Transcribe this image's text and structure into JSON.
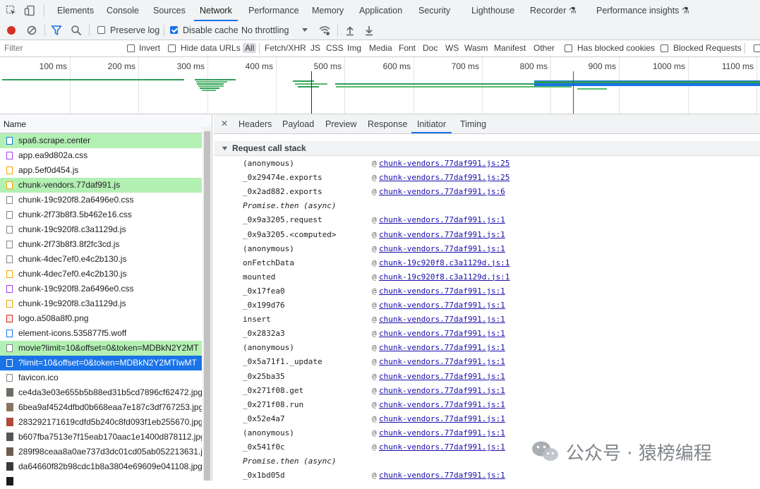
{
  "tabs": [
    "Elements",
    "Console",
    "Sources",
    "Network",
    "Performance",
    "Memory",
    "Application",
    "Security",
    "Lighthouse",
    "Recorder ⚗",
    "Performance insights ⚗"
  ],
  "active_tab": "Network",
  "controls": {
    "preserve_log": "Preserve log",
    "disable_cache": "Disable cache",
    "throttling": "No throttling"
  },
  "filter": {
    "placeholder": "Filter",
    "invert": "Invert",
    "hide_data_urls": "Hide data URLs",
    "types": [
      "All",
      "Fetch/XHR",
      "JS",
      "CSS",
      "Img",
      "Media",
      "Font",
      "Doc",
      "WS",
      "Wasm",
      "Manifest",
      "Other"
    ],
    "has_blocked_cookies": "Has blocked cookies",
    "blocked_requests": "Blocked Requests"
  },
  "timeline": {
    "ticks": [
      "100 ms",
      "200 ms",
      "300 ms",
      "400 ms",
      "500 ms",
      "600 ms",
      "700 ms",
      "800 ms",
      "900 ms",
      "1000 ms",
      "1100 ms"
    ]
  },
  "requests": {
    "header": "Name",
    "rows": [
      {
        "name": "spa6.scrape.center",
        "type": "doc",
        "hl": "green"
      },
      {
        "name": "app.ea9d802a.css",
        "type": "css",
        "hl": ""
      },
      {
        "name": "app.5ef0d454.js",
        "type": "js",
        "hl": ""
      },
      {
        "name": "chunk-vendors.77daf991.js",
        "type": "js",
        "hl": "green"
      },
      {
        "name": "chunk-19c920f8.2a6496e0.css",
        "type": "blank",
        "hl": ""
      },
      {
        "name": "chunk-2f73b8f3.5b462e16.css",
        "type": "blank",
        "hl": ""
      },
      {
        "name": "chunk-19c920f8.c3a1129d.js",
        "type": "blank",
        "hl": ""
      },
      {
        "name": "chunk-2f73b8f3.8f2fc3cd.js",
        "type": "blank",
        "hl": ""
      },
      {
        "name": "chunk-4dec7ef0.e4c2b130.js",
        "type": "blank",
        "hl": ""
      },
      {
        "name": "chunk-4dec7ef0.e4c2b130.js",
        "type": "js",
        "hl": ""
      },
      {
        "name": "chunk-19c920f8.2a6496e0.css",
        "type": "css",
        "hl": ""
      },
      {
        "name": "chunk-19c920f8.c3a1129d.js",
        "type": "js",
        "hl": ""
      },
      {
        "name": "logo.a508a8f0.png",
        "type": "img",
        "hl": ""
      },
      {
        "name": "element-icons.535877f5.woff",
        "type": "font",
        "hl": ""
      },
      {
        "name": "movie?limit=10&offset=0&token=MDBkN2Y2MT",
        "type": "blank",
        "hl": "green"
      },
      {
        "name": "?limit=10&offset=0&token=MDBkN2Y2MTIwMT",
        "type": "blank",
        "hl": "blue"
      },
      {
        "name": "favicon.ico",
        "type": "blank",
        "hl": ""
      },
      {
        "name": "ce4da3e03e655b5b88ed31b5cd7896cf62472.jpg",
        "type": "thumb",
        "hl": ""
      },
      {
        "name": "6bea9af4524dfbd0b668eaa7e187c3df767253.jpg",
        "type": "thumb",
        "hl": ""
      },
      {
        "name": "283292171619cdfd5b240c8fd093f1eb255670.jpg",
        "type": "thumb",
        "hl": ""
      },
      {
        "name": "b607fba7513e7f15eab170aac1e1400d878112.jpg",
        "type": "thumb",
        "hl": ""
      },
      {
        "name": "289f98ceaa8a0ae737d3dc01cd05ab052213631.jp",
        "type": "thumb",
        "hl": ""
      },
      {
        "name": "da64660f82b98cdc1b8a3804e69609e041108.jpg",
        "type": "thumb",
        "hl": ""
      },
      {
        "name": "",
        "type": "thumb",
        "hl": ""
      }
    ]
  },
  "details": {
    "close": "✕",
    "tabs": [
      "Headers",
      "Payload",
      "Preview",
      "Response",
      "Initiator",
      "Timing"
    ],
    "active_tab": "Initiator",
    "section_title": "Request call stack",
    "frames": [
      {
        "fn": "(anonymous)",
        "at": "@",
        "link": "chunk-vendors.77daf991.js:25"
      },
      {
        "fn": "_0x29474e.exports",
        "at": "@",
        "link": "chunk-vendors.77daf991.js:25"
      },
      {
        "fn": "_0x2ad882.exports",
        "at": "@",
        "link": "chunk-vendors.77daf991.js:6"
      },
      {
        "fn": "Promise.then (async)",
        "at": "",
        "link": "",
        "async": true
      },
      {
        "fn": "_0x9a3205.request",
        "at": "@",
        "link": "chunk-vendors.77daf991.js:1"
      },
      {
        "fn": "_0x9a3205.<computed>",
        "at": "@",
        "link": "chunk-vendors.77daf991.js:1"
      },
      {
        "fn": "(anonymous)",
        "at": "@",
        "link": "chunk-vendors.77daf991.js:1"
      },
      {
        "fn": "onFetchData",
        "at": "@",
        "link": "chunk-19c920f8.c3a1129d.js:1"
      },
      {
        "fn": "mounted",
        "at": "@",
        "link": "chunk-19c920f8.c3a1129d.js:1"
      },
      {
        "fn": "_0x17fea0",
        "at": "@",
        "link": "chunk-vendors.77daf991.js:1"
      },
      {
        "fn": "_0x199d76",
        "at": "@",
        "link": "chunk-vendors.77daf991.js:1"
      },
      {
        "fn": "insert",
        "at": "@",
        "link": "chunk-vendors.77daf991.js:1"
      },
      {
        "fn": "_0x2832a3",
        "at": "@",
        "link": "chunk-vendors.77daf991.js:1"
      },
      {
        "fn": "(anonymous)",
        "at": "@",
        "link": "chunk-vendors.77daf991.js:1"
      },
      {
        "fn": "_0x5a71f1._update",
        "at": "@",
        "link": "chunk-vendors.77daf991.js:1"
      },
      {
        "fn": "_0x25ba35",
        "at": "@",
        "link": "chunk-vendors.77daf991.js:1"
      },
      {
        "fn": "_0x271f08.get",
        "at": "@",
        "link": "chunk-vendors.77daf991.js:1"
      },
      {
        "fn": "_0x271f08.run",
        "at": "@",
        "link": "chunk-vendors.77daf991.js:1"
      },
      {
        "fn": "_0x52e4a7",
        "at": "@",
        "link": "chunk-vendors.77daf991.js:1"
      },
      {
        "fn": "(anonymous)",
        "at": "@",
        "link": "chunk-vendors.77daf991.js:1"
      },
      {
        "fn": "_0x541f0c",
        "at": "@",
        "link": "chunk-vendors.77daf991.js:1"
      },
      {
        "fn": "Promise.then (async)",
        "at": "",
        "link": "",
        "async": true
      },
      {
        "fn": "_0x1bd05d",
        "at": "@",
        "link": "chunk-vendors.77daf991.js:1"
      }
    ]
  },
  "watermark": "公众号 · 猿榜编程",
  "colors": {
    "accent": "#1a73e8",
    "row_green": "#b3f0b3",
    "row_selected": "#1a73e8",
    "record": "#d93025",
    "link": "#1a0dab"
  }
}
